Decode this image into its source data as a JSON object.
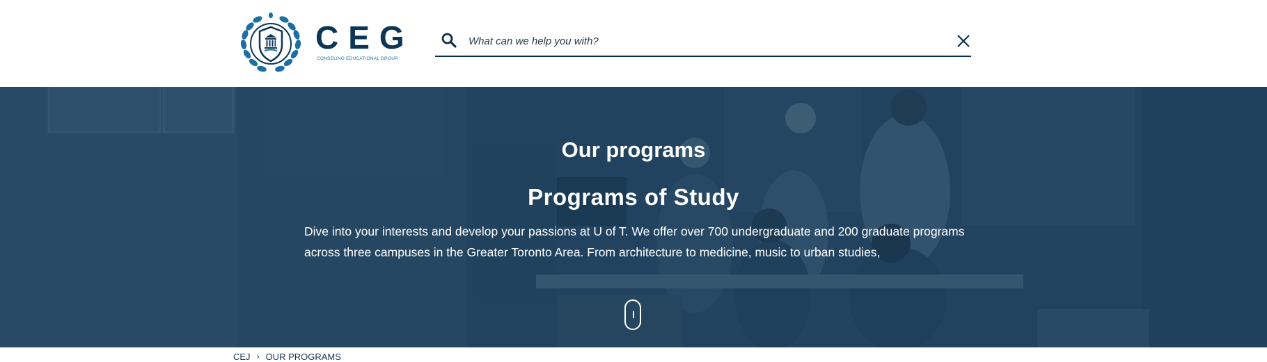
{
  "header": {
    "logo": {
      "wordmark": "CEG",
      "tagline": "CONSELING EDUCATIONAL GROUP",
      "emblem_icon": "laurel-shield-icon"
    },
    "search": {
      "placeholder": "What can we help you with?",
      "value": "",
      "search_icon": "search-icon",
      "close_icon": "close-icon"
    },
    "colors": {
      "brand": "#0d3556",
      "accent": "#1c6fa2"
    }
  },
  "hero": {
    "eyebrow": "Our programs",
    "title": "Programs of Study",
    "text": "Dive into your interests and develop your passions at U of T. We offer over 700 undergraduate and 200 graduate programs across three campuses in the Greater Toronto Area. From architecture to medicine, music to urban studies,",
    "scroll_icon": "mouse-scroll-icon",
    "overlay_color": "#153a58"
  },
  "breadcrumb": {
    "items": [
      "CEJ",
      "OUR PROGRAMS"
    ],
    "separator_icon": "chevron-right-icon"
  }
}
